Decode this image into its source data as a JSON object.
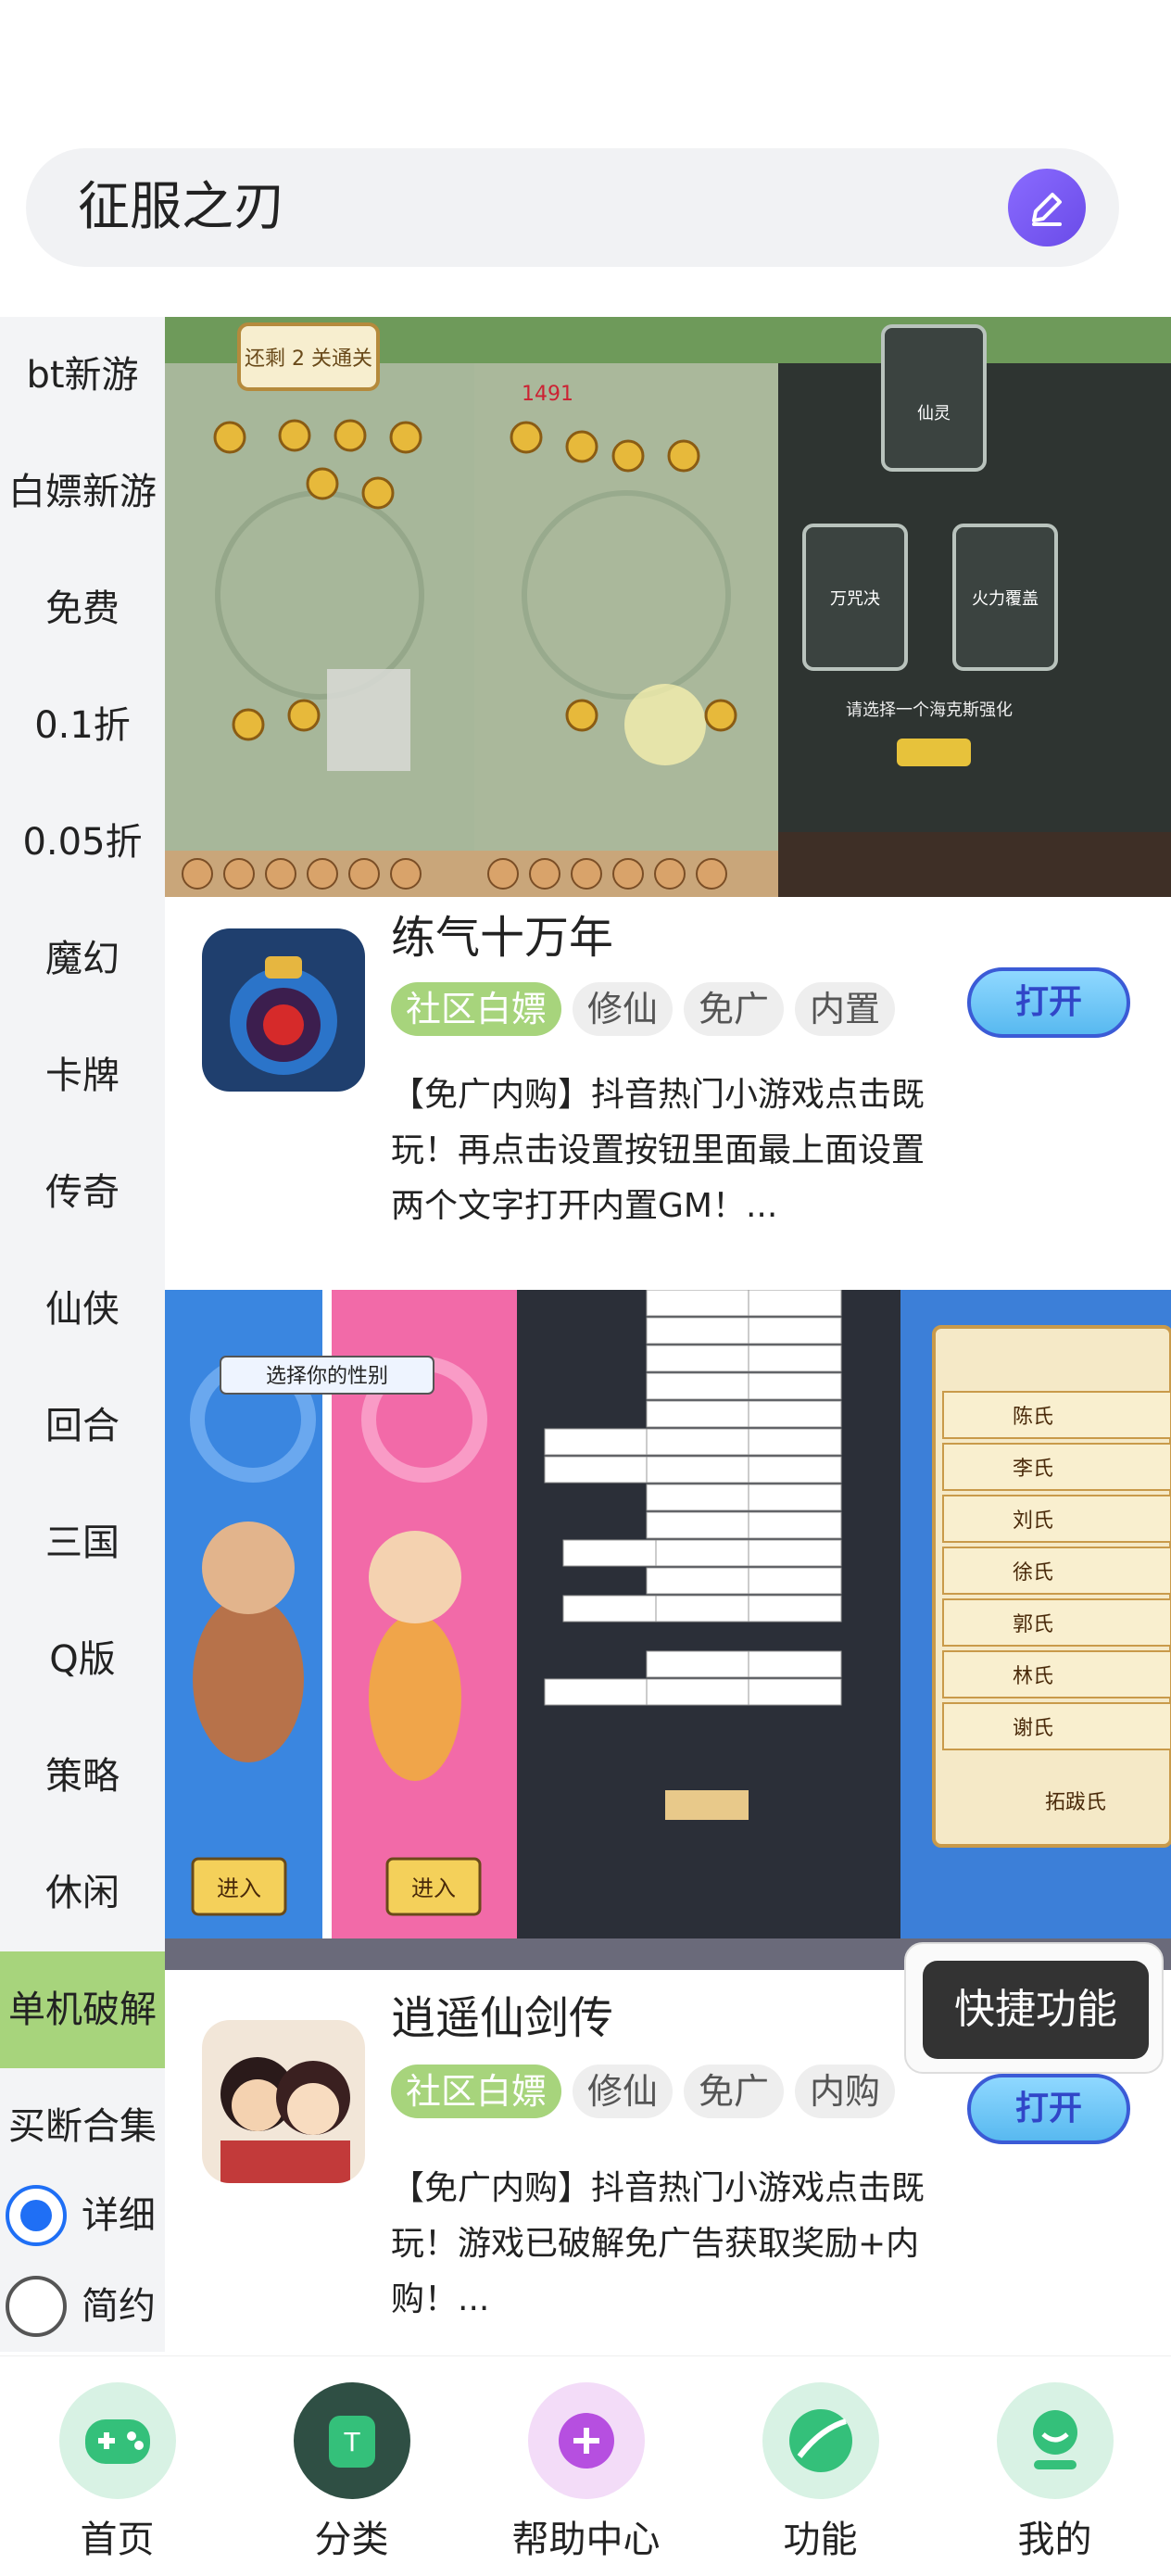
{
  "search": {
    "query": "征服之刃"
  },
  "sidebar": {
    "items": [
      {
        "label": "bt新游"
      },
      {
        "label": "白嫖新游"
      },
      {
        "label": "免费"
      },
      {
        "label": "0.1折"
      },
      {
        "label": "0.05折"
      },
      {
        "label": "魔幻"
      },
      {
        "label": "卡牌"
      },
      {
        "label": "传奇"
      },
      {
        "label": "仙侠"
      },
      {
        "label": "回合"
      },
      {
        "label": "三国"
      },
      {
        "label": "Q版"
      },
      {
        "label": "策略"
      },
      {
        "label": "休闲"
      },
      {
        "label": "单机破解"
      },
      {
        "label": "买断合集"
      }
    ],
    "active": "单机破解",
    "view_modes": [
      {
        "label": "详细",
        "checked": true
      },
      {
        "label": "简约",
        "checked": false
      }
    ]
  },
  "banner1": {
    "levels_left_text": "还剩 2 关通关",
    "card_titles": [
      "仙灵",
      "万咒决",
      "火力覆盖"
    ],
    "choose_text": "请选择一个海克斯强化",
    "score": "1491"
  },
  "games": [
    {
      "title": "练气十万年",
      "tags": [
        "社区白嫖",
        "修仙",
        "免广",
        "内置"
      ],
      "open_label": "打开",
      "description": "【免广内购】抖音热门小游戏点击既玩！再点击设置按钮里面最上面设置两个文字打开内置GM！..."
    },
    {
      "title": "逍遥仙剑传",
      "tags": [
        "社区白嫖",
        "修仙",
        "免广",
        "内购"
      ],
      "open_label": "打开",
      "description": "【免广内购】抖音热门小游戏点击既玩！游戏已破解免广告获取奖励+内购！..."
    }
  ],
  "banner2": {
    "gender_prompt": "选择你的性别",
    "enter_label": "进入",
    "ranking": [
      "陈氏",
      "李氏",
      "刘氏",
      "徐氏",
      "郭氏",
      "林氏",
      "谢氏"
    ],
    "my_surname": "拓跋氏"
  },
  "quick_function": {
    "label": "快捷功能"
  },
  "bottom_nav": [
    {
      "label": "首页",
      "icon": "gamepad-icon",
      "color": "#d8f2e4"
    },
    {
      "label": "分类",
      "icon": "category-icon",
      "color": "#2f4f44"
    },
    {
      "label": "帮助中心",
      "icon": "plus-icon",
      "color": "#f3dcf8"
    },
    {
      "label": "功能",
      "icon": "planet-icon",
      "color": "#d8f2e4"
    },
    {
      "label": "我的",
      "icon": "profile-icon",
      "color": "#d8f2e4"
    }
  ]
}
